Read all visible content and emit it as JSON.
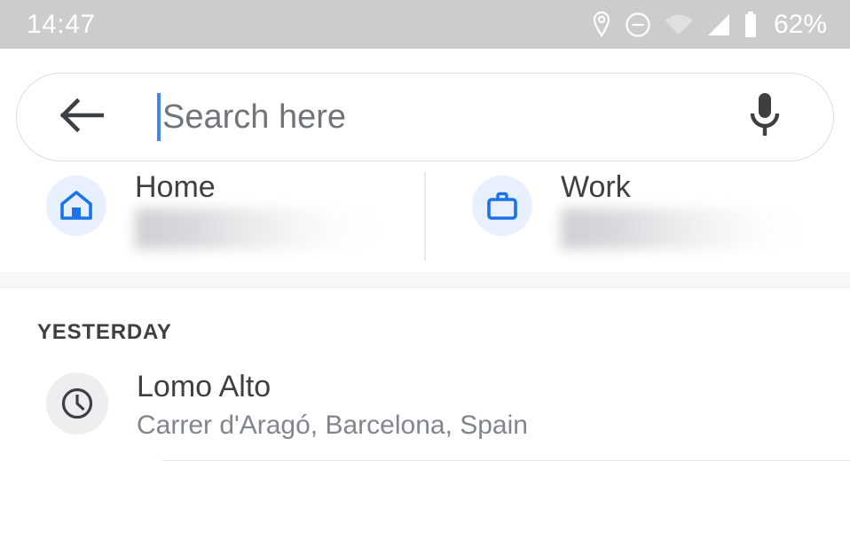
{
  "status_bar": {
    "time": "14:47",
    "battery_percent": "62%",
    "icons": [
      "location-pin-icon",
      "do-not-disturb-icon",
      "wifi-icon",
      "cell-signal-icon",
      "battery-icon"
    ],
    "background_color": "#cccccc",
    "text_color": "#ffffff"
  },
  "search": {
    "placeholder": "Search here",
    "value": "",
    "back_icon": "back-arrow-icon",
    "mic_icon": "microphone-icon",
    "caret_color": "#4285f4"
  },
  "shortcuts": {
    "accent_color": "#1a73e8",
    "circle_color": "#e8f0fe",
    "items": [
      {
        "label": "Home",
        "icon": "home-icon",
        "address": ""
      },
      {
        "label": "Work",
        "icon": "briefcase-icon",
        "address": ""
      }
    ]
  },
  "history": {
    "section_header": "YESTERDAY",
    "items": [
      {
        "icon": "clock-icon",
        "title": "Lomo Alto",
        "subtitle": "Carrer d'Aragó, Barcelona, Spain"
      }
    ]
  }
}
